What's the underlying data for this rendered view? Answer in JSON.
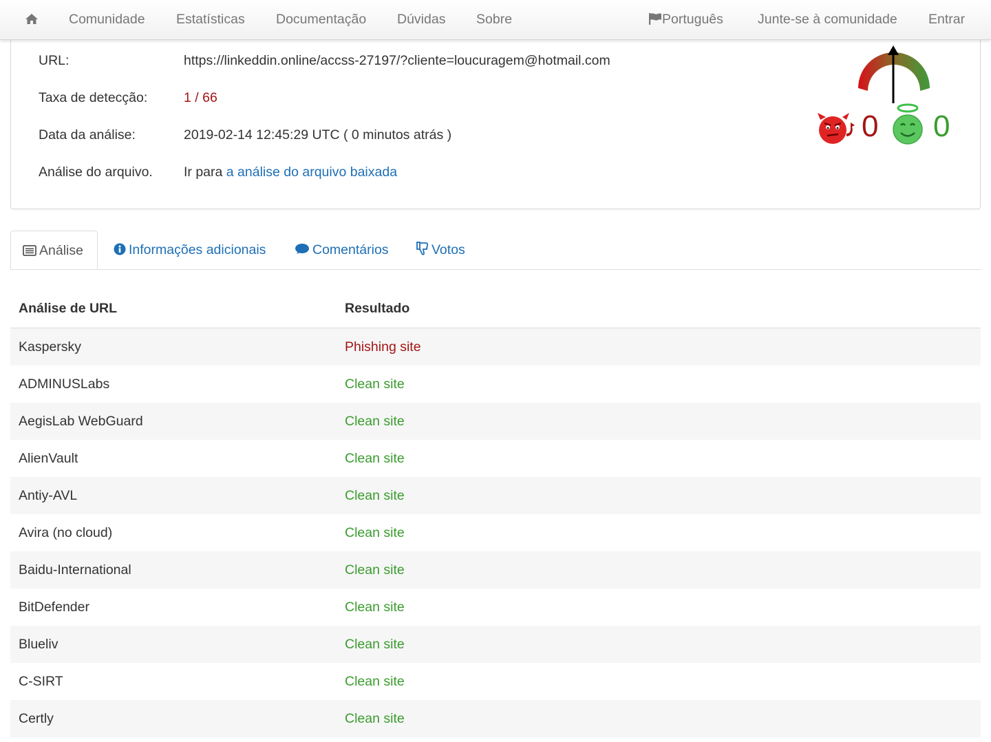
{
  "nav": {
    "home_icon": "home-icon",
    "items": [
      "Comunidade",
      "Estatísticas",
      "Documentação",
      "Dúvidas",
      "Sobre"
    ],
    "language": "Português",
    "language_icon": "flag-icon",
    "join": "Junte-se à comunidade",
    "login": "Entrar"
  },
  "details": {
    "url_label": "URL:",
    "url_value": "https://linkeddin.online/accss-27197/?cliente=loucuragem@hotmail.com",
    "detection_label": "Taxa de detecção:",
    "detection_value": "1 / 66",
    "date_label": "Data da análise:",
    "date_value": "2019-02-14 12:45:29 UTC ( 0 minutos atrás )",
    "file_label": "Análise do arquivo.",
    "file_prefix": "Ir para",
    "file_link": "a análise do arquivo baixada"
  },
  "votes": {
    "malicious_count": "0",
    "harmless_count": "0",
    "malicious_icon": "devil-face-icon",
    "harmless_icon": "angel-face-icon",
    "colors": {
      "malicious": "#a31515",
      "harmless": "#3a9c2e"
    }
  },
  "tabs": [
    {
      "label": "Análise",
      "icon": "list-icon",
      "active": true
    },
    {
      "label": "Informações adicionais",
      "icon": "info-icon",
      "active": false
    },
    {
      "label": "Comentários",
      "icon": "comment-icon",
      "active": false
    },
    {
      "label": "Votos",
      "icon": "thumbs-down-icon",
      "active": false
    }
  ],
  "table": {
    "headers": [
      "Análise de URL",
      "Resultado"
    ],
    "rows": [
      {
        "engine": "Kaspersky",
        "result": "Phishing site",
        "status": "malicious"
      },
      {
        "engine": "ADMINUSLabs",
        "result": "Clean site",
        "status": "clean"
      },
      {
        "engine": "AegisLab WebGuard",
        "result": "Clean site",
        "status": "clean"
      },
      {
        "engine": "AlienVault",
        "result": "Clean site",
        "status": "clean"
      },
      {
        "engine": "Antiy-AVL",
        "result": "Clean site",
        "status": "clean"
      },
      {
        "engine": "Avira (no cloud)",
        "result": "Clean site",
        "status": "clean"
      },
      {
        "engine": "Baidu-International",
        "result": "Clean site",
        "status": "clean"
      },
      {
        "engine": "BitDefender",
        "result": "Clean site",
        "status": "clean"
      },
      {
        "engine": "Blueliv",
        "result": "Clean site",
        "status": "clean"
      },
      {
        "engine": "C-SIRT",
        "result": "Clean site",
        "status": "clean"
      },
      {
        "engine": "Certly",
        "result": "Clean site",
        "status": "clean"
      }
    ]
  }
}
